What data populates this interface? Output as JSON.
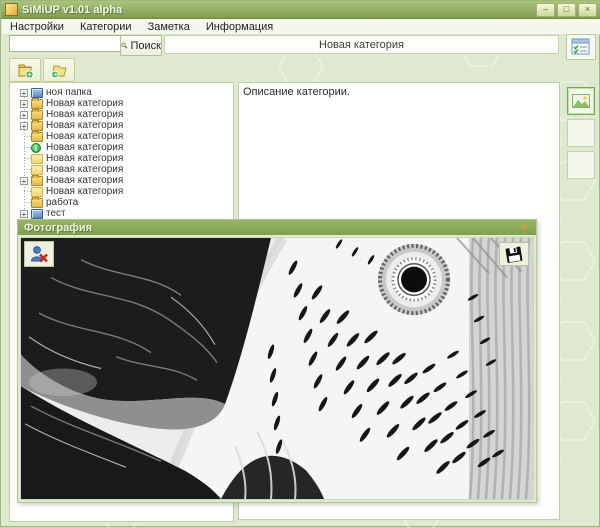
{
  "colors": {
    "titlebar_green": "#8aa659",
    "photo_titlebar_green": "#8db05e",
    "window_bg": "#dfe9cf",
    "panel_border": "#bcd0a2",
    "close_x_orange": "#e29a3c"
  },
  "window": {
    "title": "SiMiUP v1.01 alpha",
    "minimize_glyph": "–",
    "maximize_glyph": "□",
    "close_glyph": "×"
  },
  "menu": {
    "items": [
      {
        "label": "Настройки"
      },
      {
        "label": "Категории"
      },
      {
        "label": "Заметка"
      },
      {
        "label": "Информация"
      }
    ]
  },
  "search": {
    "input_value": "",
    "button_label": "Поиск"
  },
  "category_field": {
    "value": "Новая категория"
  },
  "tree": {
    "expander_glyph": "+",
    "items": [
      {
        "label": "ноя папка",
        "icon": "computer",
        "expandable": true
      },
      {
        "label": "Новая категория",
        "icon": "folder",
        "expandable": true
      },
      {
        "label": "Новая категория",
        "icon": "folder",
        "expandable": true
      },
      {
        "label": "Новая категория",
        "icon": "folder",
        "expandable": true
      },
      {
        "label": "Новая категория",
        "icon": "folder",
        "expandable": false
      },
      {
        "label": "Новая категория",
        "icon": "info",
        "expandable": false
      },
      {
        "label": "Новая категория",
        "icon": "folder-plain",
        "expandable": false
      },
      {
        "label": "Новая категория",
        "icon": "folder-plain",
        "expandable": false
      },
      {
        "label": "Новая категория",
        "icon": "folder",
        "expandable": true
      },
      {
        "label": "Новая категория",
        "icon": "folder-plain",
        "expandable": false
      },
      {
        "label": "работа",
        "icon": "folder",
        "expandable": false
      },
      {
        "label": "тест",
        "icon": "computer",
        "expandable": true
      }
    ]
  },
  "description_panel": {
    "text": "Описание категории."
  },
  "photo_window": {
    "title": "Фотография",
    "close_glyph": "×"
  }
}
